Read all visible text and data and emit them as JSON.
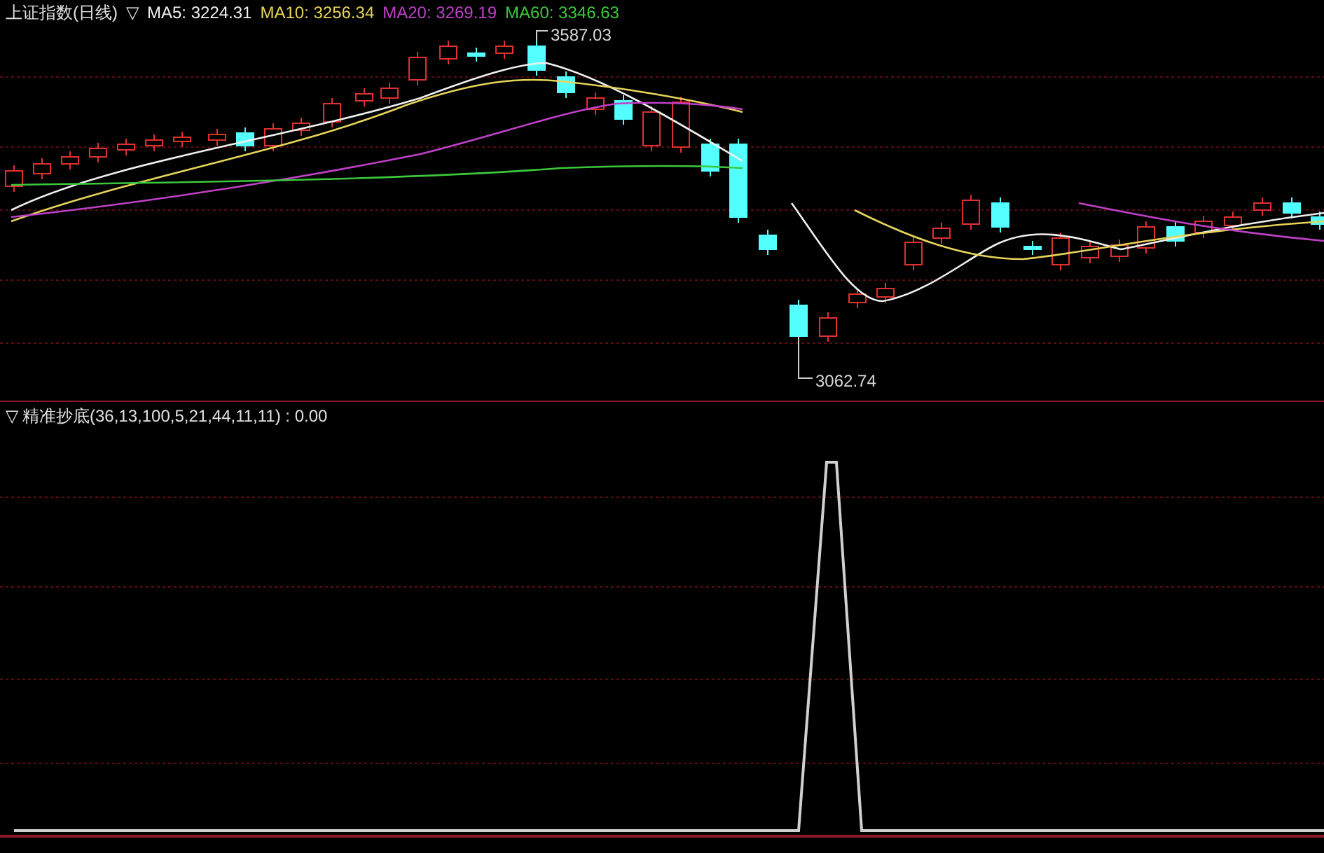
{
  "price_panel": {
    "title": "上证指数(日线)",
    "toggle": "▽",
    "moving_averages": [
      {
        "label": "MA5: 3224.31",
        "color": "#f0f0f0"
      },
      {
        "label": "MA10: 3256.34",
        "color": "#e6d35a"
      },
      {
        "label": "MA20: 3269.19",
        "color": "#c040c8"
      },
      {
        "label": "MA60: 3346.63",
        "color": "#3cc83c"
      }
    ],
    "high_label": "3587.03",
    "low_label": "3062.74"
  },
  "indicator_panel": {
    "toggle": "▽",
    "title": "精准抄底(36,13,100,5,21,44,11,11) : 0.00"
  }
}
